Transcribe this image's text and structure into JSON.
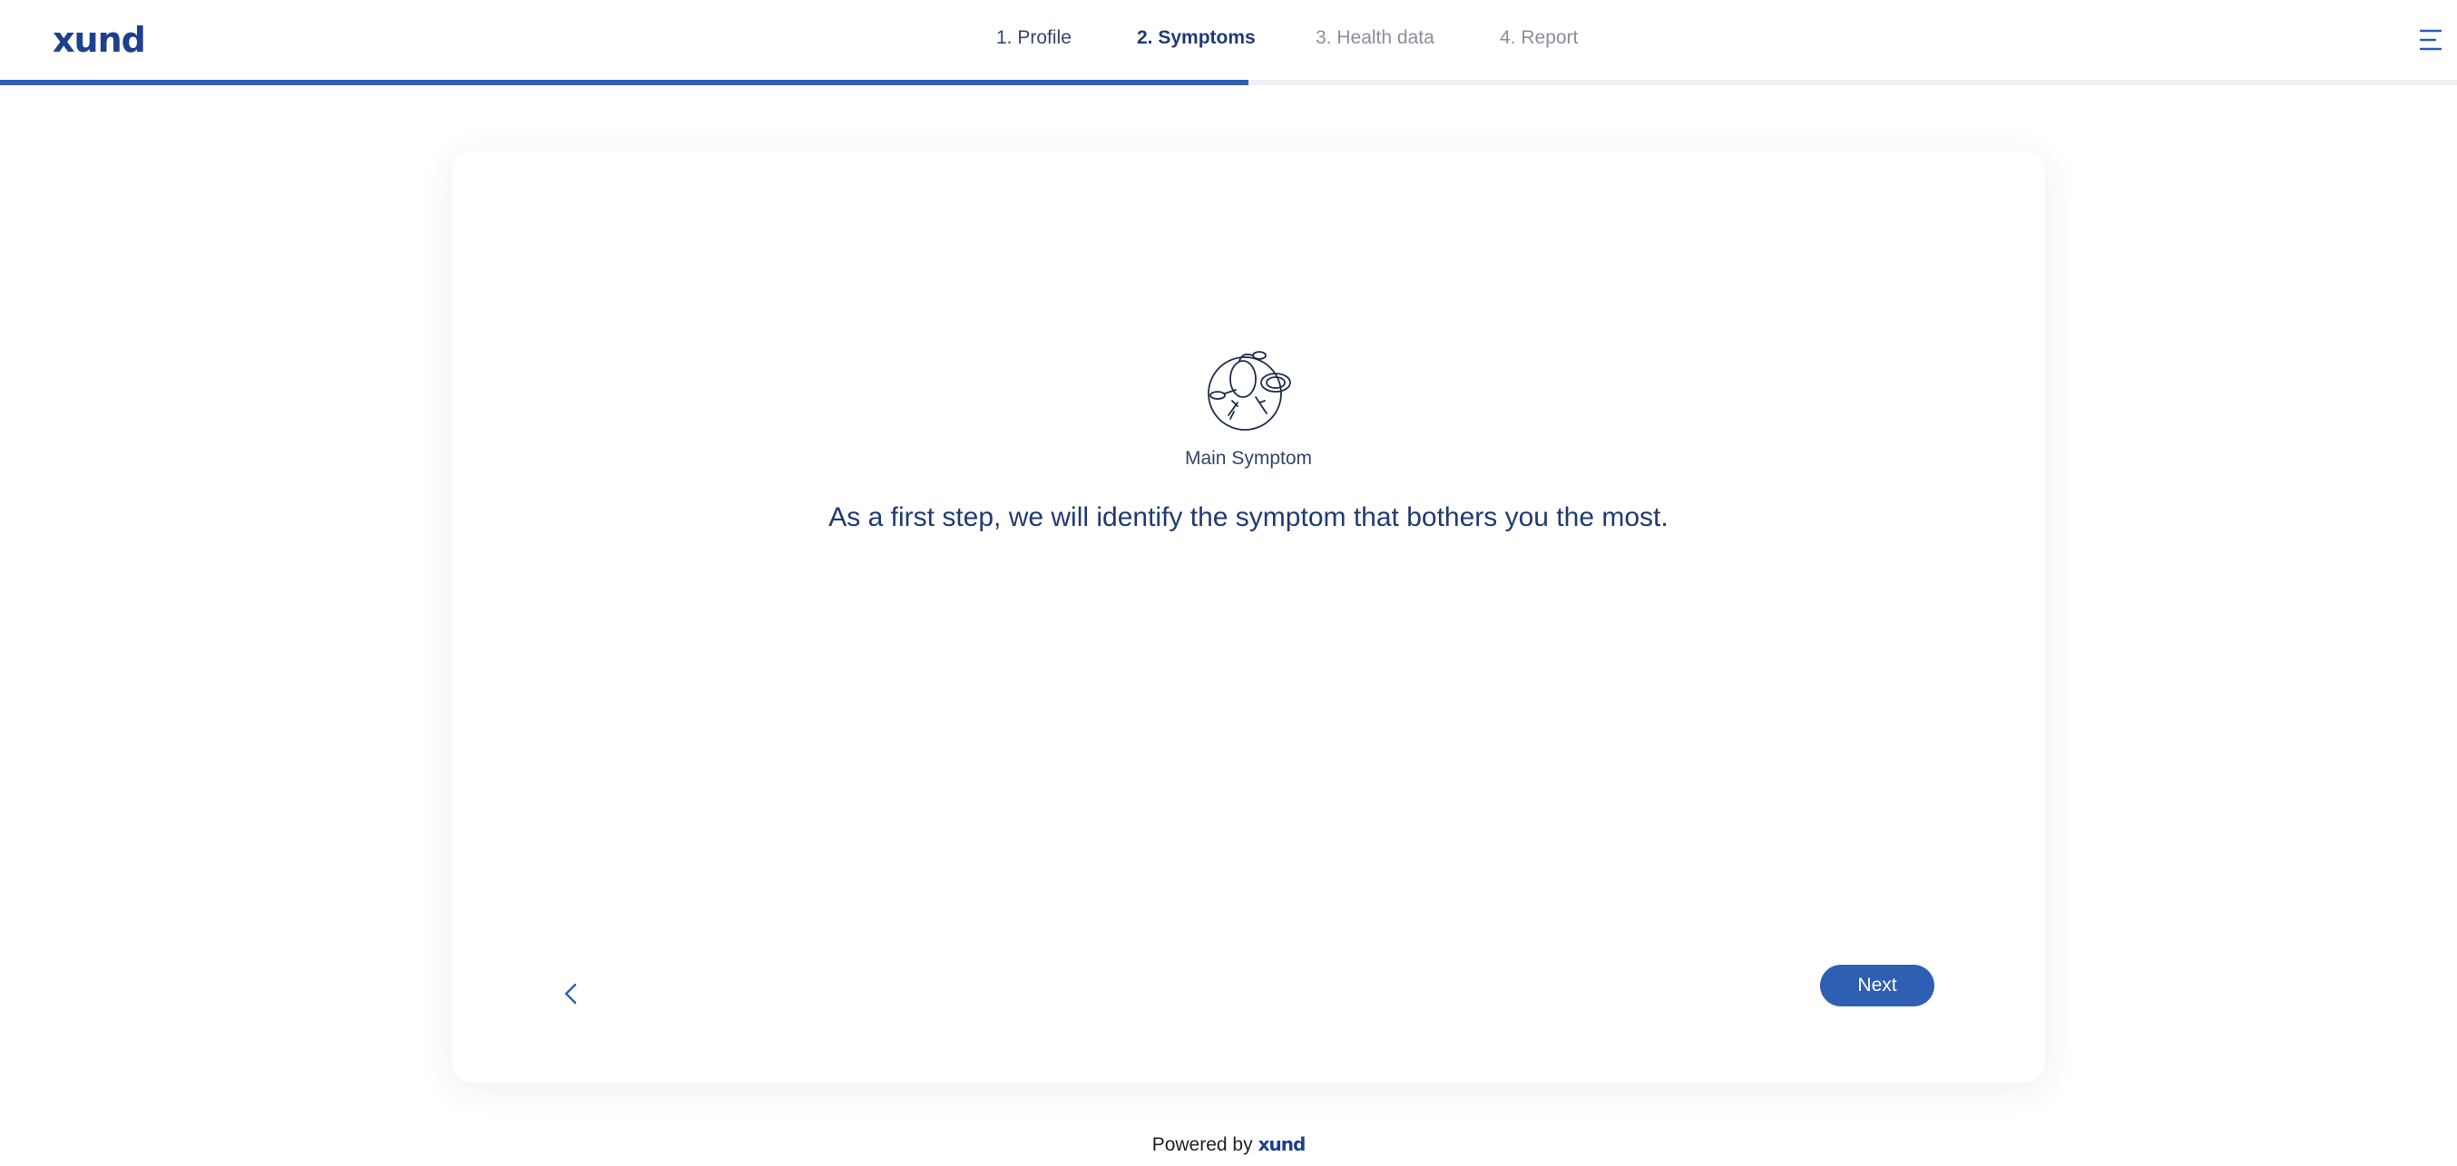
{
  "brand": {
    "logo_text": "xund",
    "accent_color": "#2f5fb3",
    "text_color": "#1f3b72"
  },
  "header": {
    "steps": [
      {
        "label": "1. Profile",
        "state": "done"
      },
      {
        "label": "2. Symptoms",
        "state": "active"
      },
      {
        "label": "3. Health data",
        "state": "upcoming"
      },
      {
        "label": "4. Report",
        "state": "upcoming"
      }
    ],
    "menu_icon": "hamburger-menu-icon"
  },
  "progress": {
    "value_percent": 50.8
  },
  "card": {
    "illustration_icon": "main-symptom-illustration-icon",
    "section_label": "Main Symptom",
    "headline": "As a first step, we will identify the symptom that bothers you the most.",
    "back_icon": "chevron-left-icon",
    "next_label": "Next"
  },
  "footer": {
    "powered_by": "Powered by",
    "logo_text": "xund"
  }
}
